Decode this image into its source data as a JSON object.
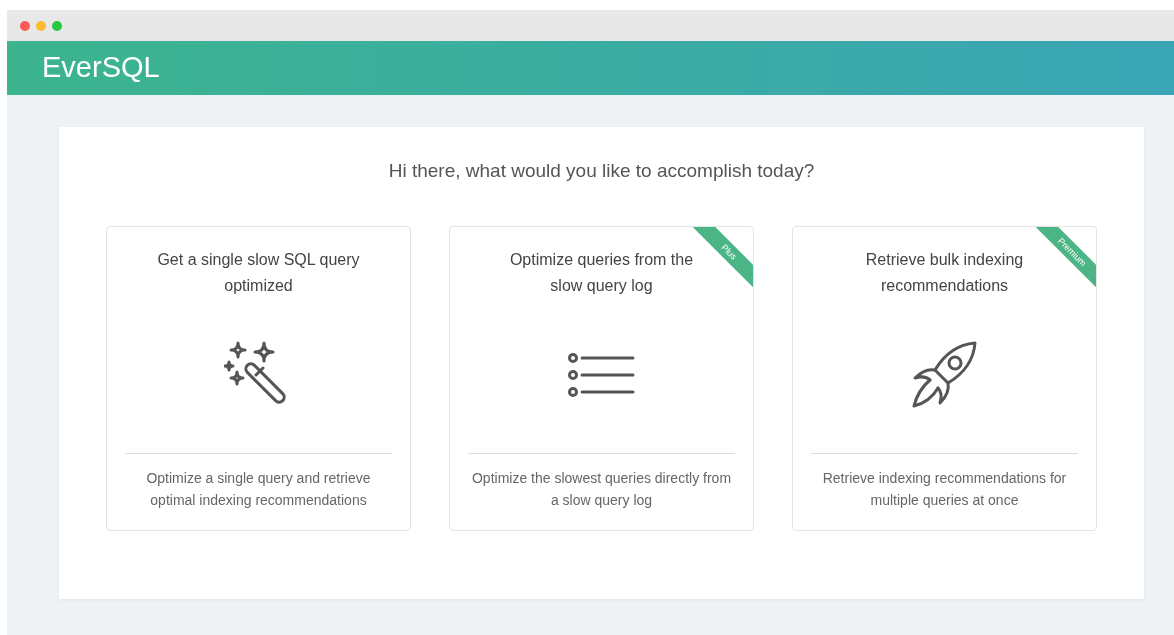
{
  "window": {
    "controls": [
      {
        "color": "#fc5b57"
      },
      {
        "color": "#fdbb2e"
      },
      {
        "color": "#27c93f"
      }
    ]
  },
  "header": {
    "logo": "EverSQL"
  },
  "prompt": "Hi there, what would you like to accomplish today?",
  "options": [
    {
      "title": "Get a single slow SQL query optimized",
      "description": "Optimize a single query and retrieve optimal indexing recommendations"
    },
    {
      "title": "Optimize queries from the slow query log",
      "ribbon": "Plus",
      "description": "Optimize the slowest queries directly from a slow query log"
    },
    {
      "title": "Retrieve bulk indexing recommendations",
      "ribbon": "Premium",
      "description": "Retrieve indexing recommendations for multiple queries at once"
    }
  ]
}
